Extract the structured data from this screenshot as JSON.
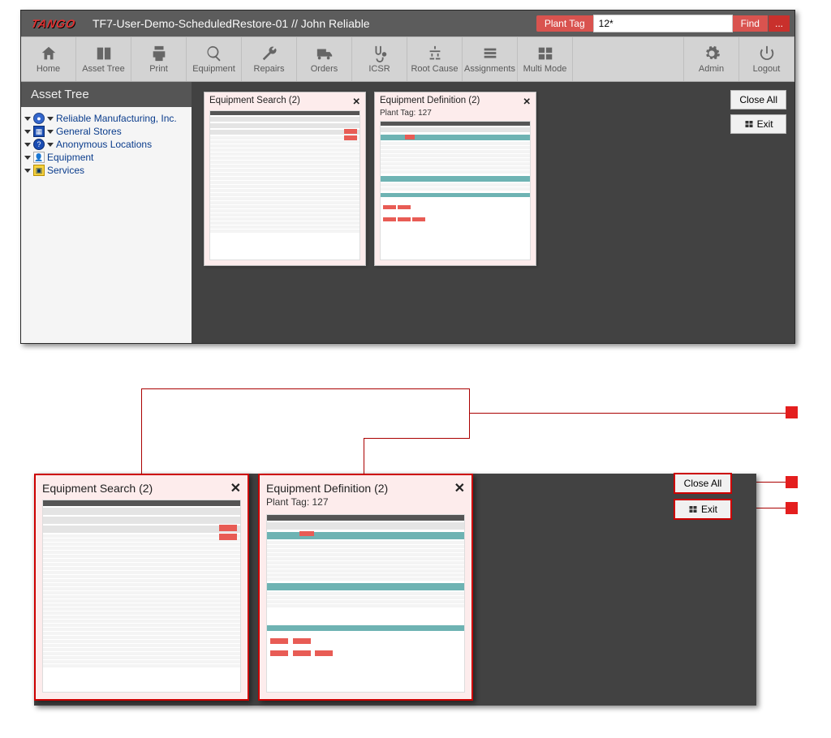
{
  "header": {
    "logo": "TANGO",
    "title": "TF7-User-Demo-ScheduledRestore-01  // John Reliable",
    "plantTagLabel": "Plant Tag",
    "searchValue": "12*",
    "findLabel": "Find",
    "moreLabel": "..."
  },
  "toolbar": [
    {
      "id": "home",
      "label": "Home"
    },
    {
      "id": "assettree",
      "label": "Asset Tree"
    },
    {
      "id": "print",
      "label": "Print"
    },
    {
      "id": "equipment",
      "label": "Equipment"
    },
    {
      "id": "repairs",
      "label": "Repairs"
    },
    {
      "id": "orders",
      "label": "Orders"
    },
    {
      "id": "icsr",
      "label": "ICSR"
    },
    {
      "id": "rootcause",
      "label": "Root Cause"
    },
    {
      "id": "assignments",
      "label": "Assignments"
    },
    {
      "id": "multimode",
      "label": "Multi Mode"
    },
    {
      "id": "admin",
      "label": "Admin"
    },
    {
      "id": "logout",
      "label": "Logout"
    }
  ],
  "sidebarTitle": "Asset Tree",
  "tree": [
    {
      "label": "Reliable Manufacturing, Inc.",
      "ico": "globe"
    },
    {
      "label": "General Stores",
      "ico": "store"
    },
    {
      "label": "Anonymous Locations",
      "ico": "q"
    },
    {
      "label": "Equipment",
      "ico": "eq"
    },
    {
      "label": "Services",
      "ico": "sv"
    }
  ],
  "actions": {
    "closeAll": "Close All",
    "exit": "Exit"
  },
  "thumb1": {
    "title": "Equipment Search (2)"
  },
  "thumb2": {
    "title": "Equipment Definition (2)",
    "sub": "Plant Tag: 127"
  },
  "zoom1": {
    "title": "Equipment Search (2)"
  },
  "zoom2": {
    "title": "Equipment Definition (2)",
    "sub": "Plant Tag: 127"
  }
}
